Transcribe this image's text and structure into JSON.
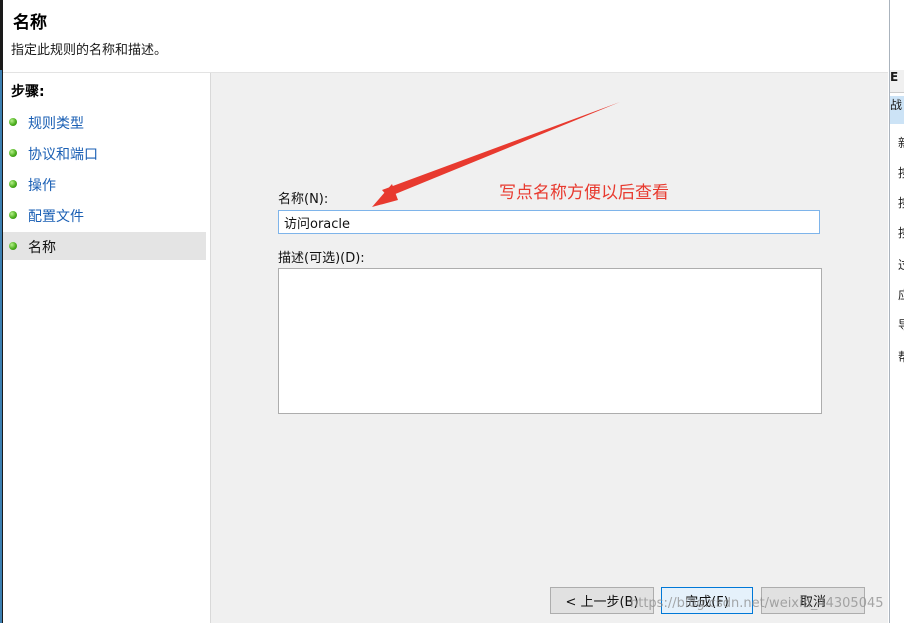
{
  "header": {
    "title": "名称",
    "subtitle": "指定此规则的名称和描述。"
  },
  "steps": {
    "heading": "步骤:",
    "items": [
      {
        "label": "规则类型",
        "active": false
      },
      {
        "label": "协议和端口",
        "active": false
      },
      {
        "label": "操作",
        "active": false
      },
      {
        "label": "配置文件",
        "active": false
      },
      {
        "label": "名称",
        "active": true
      }
    ]
  },
  "form": {
    "name_label": "名称(N):",
    "name_value": "访问oracle",
    "description_label": "描述(可选)(D):",
    "description_value": ""
  },
  "annotation": {
    "text": "写点名称方便以后查看",
    "color": "#e83a2f"
  },
  "buttons": {
    "back": "< 上一步(B)",
    "finish": "完成(F)",
    "cancel": "取消"
  },
  "background_window": {
    "header_glyph": "E",
    "highlight_glyph": "战",
    "item_glyphs": [
      "新",
      "按",
      "按",
      "按",
      "过",
      "应",
      "导",
      "帮"
    ]
  },
  "watermark": "https://blog.csdn.net/weixin_44305045"
}
